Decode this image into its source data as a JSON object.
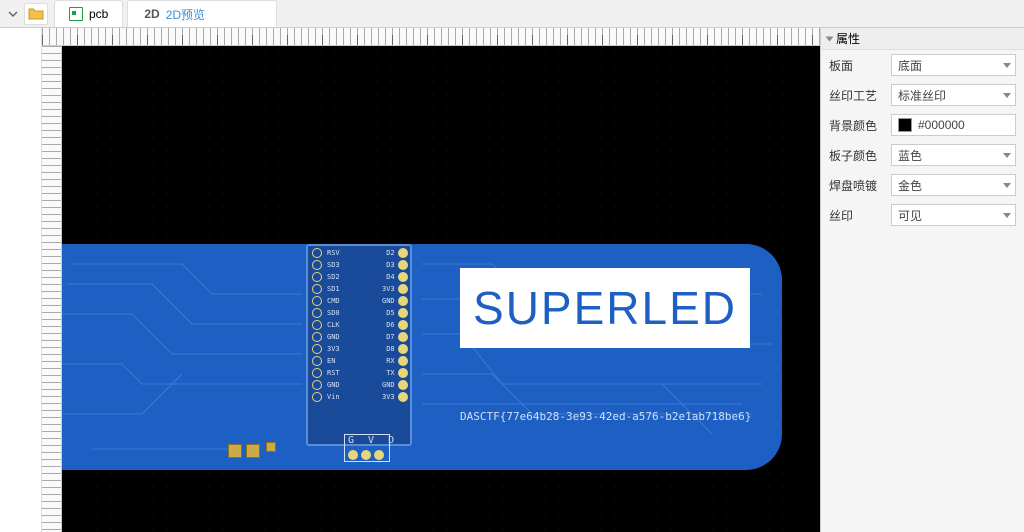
{
  "topbar": {
    "tab_pcb": "pcb",
    "tab_2d_badge": "2D",
    "tab_2d_title": "2D预览"
  },
  "rightpanel": {
    "header": "属性",
    "rows": {
      "side": {
        "label": "板面",
        "value": "底面"
      },
      "silk": {
        "label": "丝印工艺",
        "value": "标准丝印"
      },
      "bg": {
        "label": "背景颜色",
        "value": "#000000"
      },
      "board": {
        "label": "板子颜色",
        "value": "蓝色"
      },
      "pad": {
        "label": "焊盘喷镀",
        "value": "金色"
      },
      "silkv": {
        "label": "丝印",
        "value": "可见"
      }
    }
  },
  "pcb": {
    "superled_text": "SUPERLED",
    "flag_text": "DASCTF{77e64b28-3e93-42ed-a576-b2e1ab718be6}",
    "gvd_label": "G V D",
    "pins_left": [
      "RSV",
      "SD3",
      "SD2",
      "SD1",
      "CMD",
      "SD0",
      "CLK",
      "GND",
      "3V3",
      "EN",
      "RST",
      "GND",
      "Vin"
    ],
    "pins_right": [
      "D2",
      "D3",
      "D4",
      "3V3",
      "GND",
      "D5",
      "D6",
      "D7",
      "D8",
      "RX",
      "TX",
      "GND",
      "3V3"
    ]
  }
}
